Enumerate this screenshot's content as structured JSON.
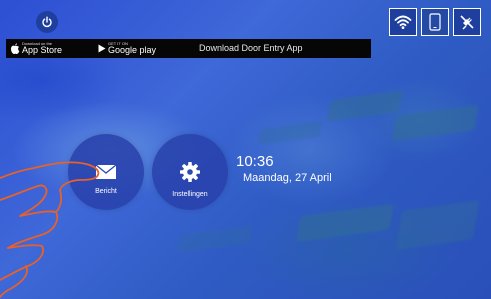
{
  "header": {
    "power_icon": "power-icon",
    "store_bar": {
      "app_store": {
        "small": "Download on the",
        "big": "App Store"
      },
      "google_play": {
        "small": "GET IT ON",
        "big": "Google play"
      },
      "download_text": "Download Door Entry App"
    },
    "status_icons": [
      "wifi-icon",
      "phone-icon",
      "plug-disconnected-icon"
    ]
  },
  "actions": [
    {
      "label": "Bericht",
      "icon": "envelope-icon"
    },
    {
      "label": "Instellingen",
      "icon": "gear-icon"
    }
  ],
  "clock": {
    "time": "10:36",
    "date": "Maandag, 27 April"
  },
  "colors": {
    "accent": "#1f3f9f",
    "background": "#2d4fd4",
    "store_bar": "#060606"
  }
}
